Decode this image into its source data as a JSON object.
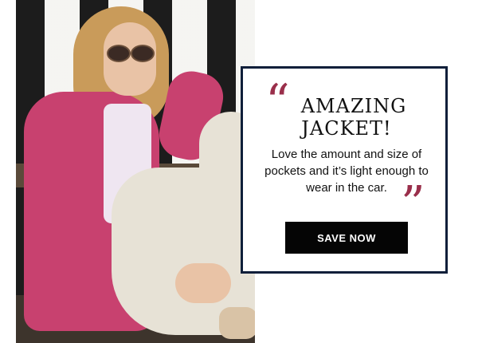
{
  "promo": {
    "headline_line1": "AMAZING",
    "headline_line2": "JACKET!",
    "review_text": "Love the amount and size of pockets and it’s light enough to wear in the car.",
    "cta_label": "SAVE NOW",
    "open_quote_glyph": "“",
    "close_quote_glyph": "”"
  },
  "colors": {
    "quote_accent": "#9a2f4b",
    "box_border": "#0f1f3a",
    "button_bg": "#050505",
    "jacket_pink": "#c8416f"
  },
  "icons": {
    "open_quote": "quote-open-icon",
    "close_quote": "quote-close-icon"
  }
}
